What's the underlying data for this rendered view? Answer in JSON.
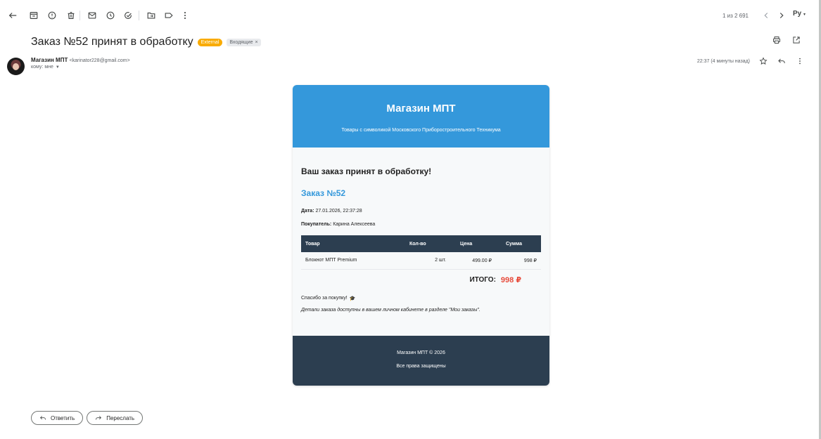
{
  "toolbar": {
    "icons": [
      "back-icon",
      "archive-icon",
      "report-spam-icon",
      "delete-icon",
      "mark-unread-icon",
      "snooze-icon",
      "add-to-tasks-icon",
      "move-to-icon",
      "label-icon",
      "more-icon"
    ],
    "pager_text": "1 из 2 691",
    "language": "Ру"
  },
  "email": {
    "subject": "Заказ №52 принят в обработку",
    "labels": {
      "external": "External",
      "inbox": "Входящие"
    },
    "sender_name": "Магазин МПТ",
    "sender_email": "<karinator228@gmail.com>",
    "to_text": "кому: мне",
    "timestamp": "22:37 (4 минуты назад)"
  },
  "message": {
    "shop_name": "Магазин МПТ",
    "tagline": "Товары с символикой Московского Приборостроительного Техникума",
    "heading": "Ваш заказ принят в обработку!",
    "order_number": "Заказ №52",
    "date_label": "Дата:",
    "date_value": "27.01.2026, 22:37:28",
    "buyer_label": "Покупатель:",
    "buyer_value": "Карина Алексеева",
    "table": {
      "headers": [
        "Товар",
        "Кол-во",
        "Цена",
        "Сумма"
      ],
      "rows": [
        [
          "Блокнот МПТ Premium",
          "2 шт.",
          "499.00 ₽",
          "998 ₽"
        ]
      ]
    },
    "total_label": "ИТОГО:",
    "total_value": "998 ₽",
    "thanks": "Спасибо за покупку!",
    "thanks_emoji": "🎓",
    "details_note": "Детали заказа доступны в вашем личном кабинете в разделе \"Мои заказы\".",
    "footer_copyright": "Магазин МПТ © 2026",
    "footer_rights": "Все права защищены"
  },
  "actions": {
    "reply": "Ответить",
    "forward": "Переслать"
  },
  "colors": {
    "header_blue": "#3498db",
    "footer_dark": "#2c3e50",
    "total_red": "#e74c3c",
    "external_label": "#f9ab00"
  }
}
